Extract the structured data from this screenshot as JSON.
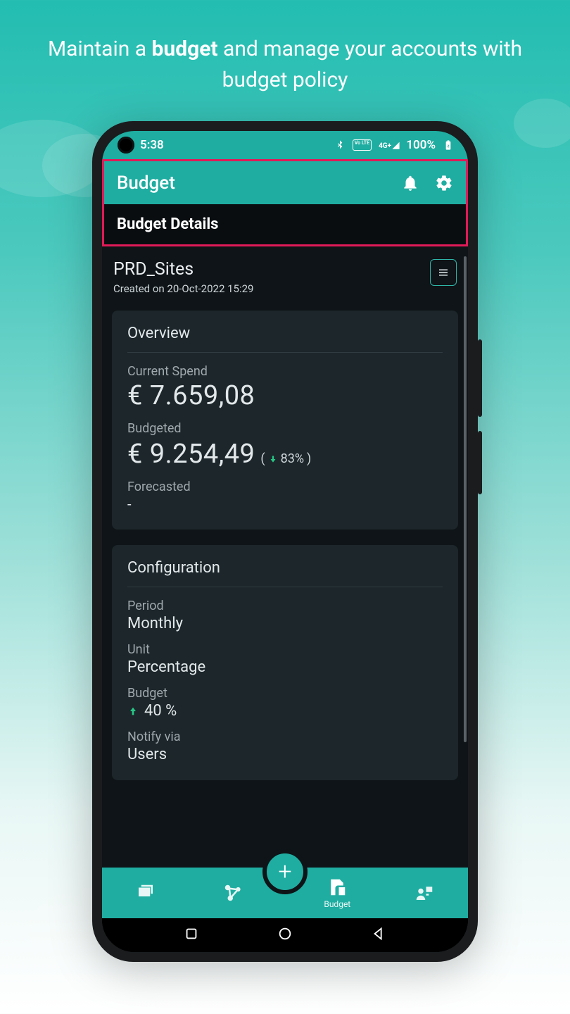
{
  "promo": {
    "prefix": "Maintain a ",
    "bold": "budget",
    "suffix": " and manage your accounts with budget policy"
  },
  "status": {
    "time": "5:38",
    "vo": "Vo LTE",
    "net": "4G+",
    "battery": "100%"
  },
  "header": {
    "title": "Budget"
  },
  "subbar": {
    "title": "Budget Details"
  },
  "budget": {
    "name": "PRD_Sites",
    "created_prefix": "Created on ",
    "created": "20-Oct-2022 15:29"
  },
  "overview": {
    "title": "Overview",
    "current_spend_label": "Current Spend",
    "current_spend": "€ 7.659,08",
    "budgeted_label": "Budgeted",
    "budgeted": "€ 9.254,49",
    "budgeted_pct": "83%",
    "forecasted_label": "Forecasted",
    "forecasted": "-"
  },
  "config": {
    "title": "Configuration",
    "period_label": "Period",
    "period": "Monthly",
    "unit_label": "Unit",
    "unit": "Percentage",
    "budget_label": "Budget",
    "budget": "40 %",
    "notify_label": "Notify via",
    "notify": "Users"
  },
  "nav": {
    "budget_label": "Budget"
  }
}
